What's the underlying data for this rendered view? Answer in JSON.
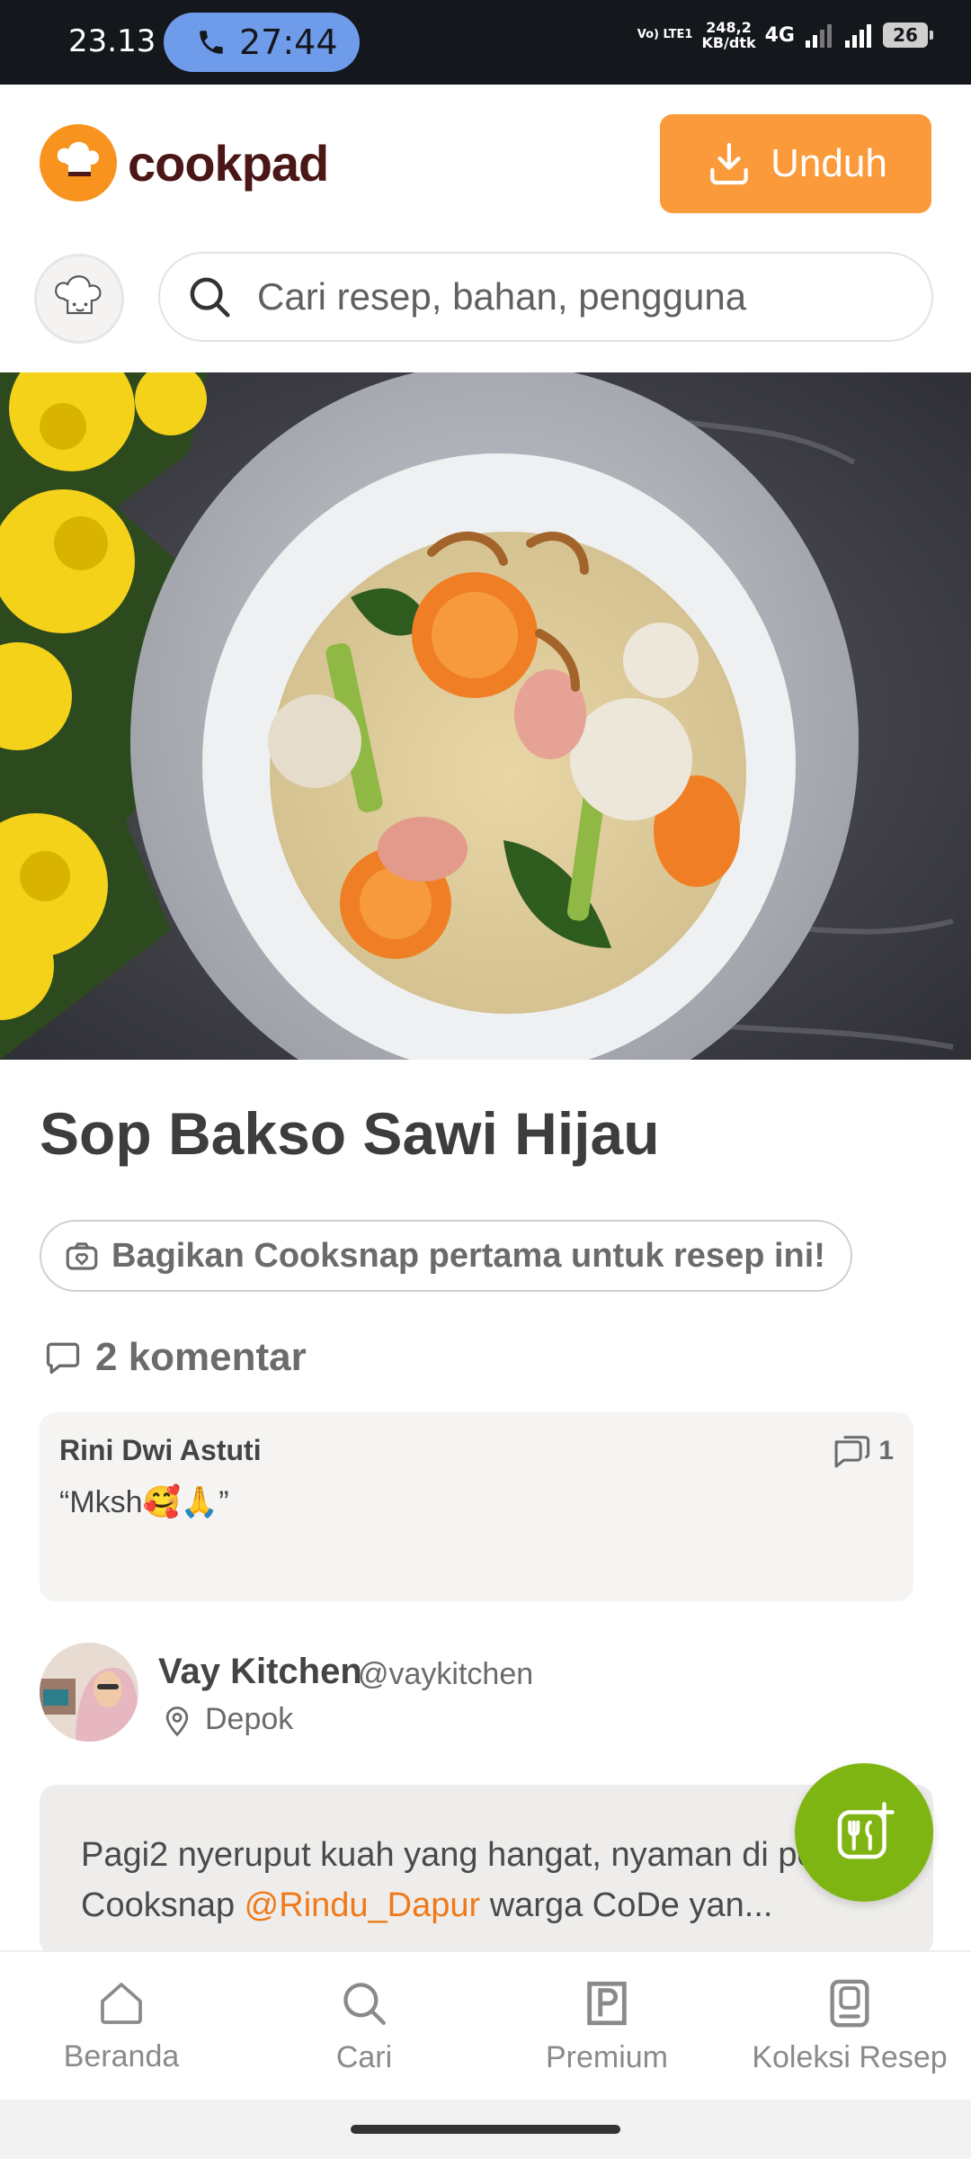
{
  "status_bar": {
    "time": "23.13",
    "call_timer": "27:44",
    "volte": "Vo) LTE1",
    "speed_value": "248,2",
    "speed_unit": "KB/dtk",
    "network": "4G",
    "battery": "26"
  },
  "header": {
    "brand": "cookpad",
    "download_label": "Unduh",
    "search_placeholder": "Cari resep, bahan, pengguna"
  },
  "recipe": {
    "title": "Sop Bakso Sawi Hijau",
    "cooksnap_label": "Bagikan Cooksnap pertama untuk resep ini!",
    "comments_label": "2 komentar",
    "comment": {
      "author": "Rini Dwi Astuti",
      "text": "“Mksh🥰🙏”",
      "reply_count": "1"
    },
    "author": {
      "name": "Vay Kitchen",
      "handle": "@vaykitchen",
      "location": "Depok"
    },
    "story": {
      "text_before": "Pagi2 nyeruput kuah yang hangat, nyaman di perut. Cooksnap ",
      "mention": "@Rindu_Dapur",
      "text_after": " warga CoDe yan..."
    }
  },
  "bottom_nav": {
    "items": [
      {
        "label": "Beranda",
        "icon": "home-icon"
      },
      {
        "label": "Cari",
        "icon": "search-icon"
      },
      {
        "label": "Premium",
        "icon": "premium-icon"
      },
      {
        "label": "Koleksi Resep",
        "icon": "collection-icon"
      }
    ]
  },
  "colors": {
    "brand_orange": "#fb9a3a",
    "fab_green": "#7fb512",
    "mention_orange": "#f07a1a"
  }
}
